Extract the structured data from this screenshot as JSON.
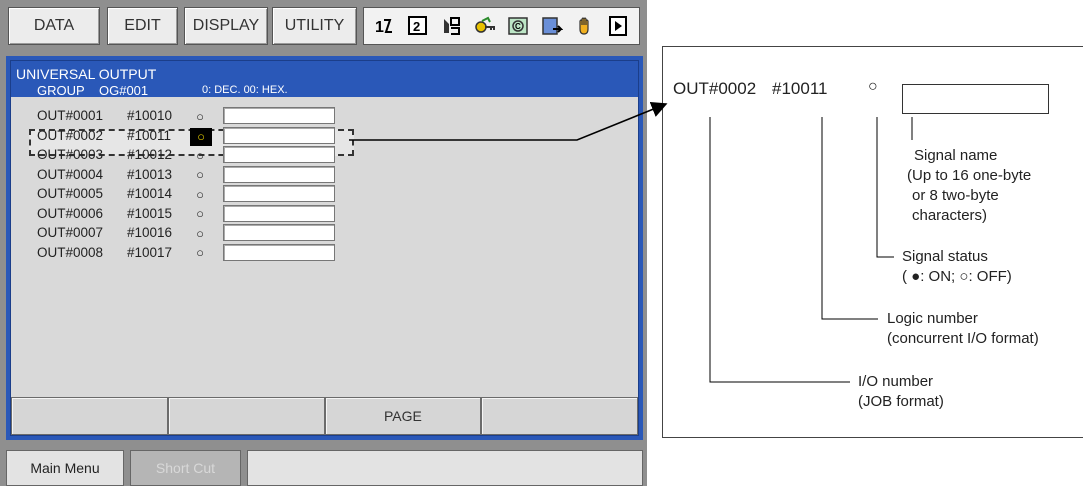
{
  "menu": {
    "data": "DATA",
    "edit": "EDIT",
    "display": "DISPLAY",
    "utility": "UTILITY"
  },
  "toolbar_icons": [
    "teach-lock-icon",
    "numeric-2-icon",
    "save-icon",
    "key-icon",
    "teach-mode-icon",
    "program-step-icon",
    "servo-hand-icon",
    "play-icon"
  ],
  "screen": {
    "title": "UNIVERSAL OUTPUT",
    "group_label": "GROUP",
    "group_value": "OG#001",
    "format_note": "0: DEC.  00: HEX.",
    "selected_row": 1,
    "rows": [
      {
        "io": "OUT#0001",
        "logic": "#10010",
        "status": "○"
      },
      {
        "io": "OUT#0002",
        "logic": "#10011",
        "status": "○"
      },
      {
        "io": "OUT#0003",
        "logic": "#10012",
        "status": "○"
      },
      {
        "io": "OUT#0004",
        "logic": "#10013",
        "status": "○"
      },
      {
        "io": "OUT#0005",
        "logic": "#10014",
        "status": "○"
      },
      {
        "io": "OUT#0006",
        "logic": "#10015",
        "status": "○"
      },
      {
        "io": "OUT#0007",
        "logic": "#10016",
        "status": "○"
      },
      {
        "io": "OUT#0008",
        "logic": "#10017",
        "status": "○"
      }
    ],
    "fkeys": [
      "",
      "",
      "PAGE",
      ""
    ]
  },
  "bottom": {
    "main_menu": "Main Menu",
    "short_cut": "Short Cut"
  },
  "callout": {
    "io": "OUT#0002",
    "logic": "#10011",
    "status_symbol": "○",
    "signal_name_l1": "Signal name",
    "signal_name_l2": "(Up to 16 one-byte",
    "signal_name_l3": "or 8 two-byte",
    "signal_name_l4": "characters)",
    "signal_status_l1": "Signal status",
    "signal_status_l2": "( ●: ON;  ○: OFF)",
    "logic_number_l1": "Logic number",
    "logic_number_l2": "(concurrent I/O format)",
    "io_number_l1": "I/O number",
    "io_number_l2": "(JOB format)"
  },
  "colors": {
    "accent": "#2a58b8",
    "selected_bg": "#000000",
    "selected_fg": "#e8d000",
    "frame": "#8f8f8f"
  }
}
